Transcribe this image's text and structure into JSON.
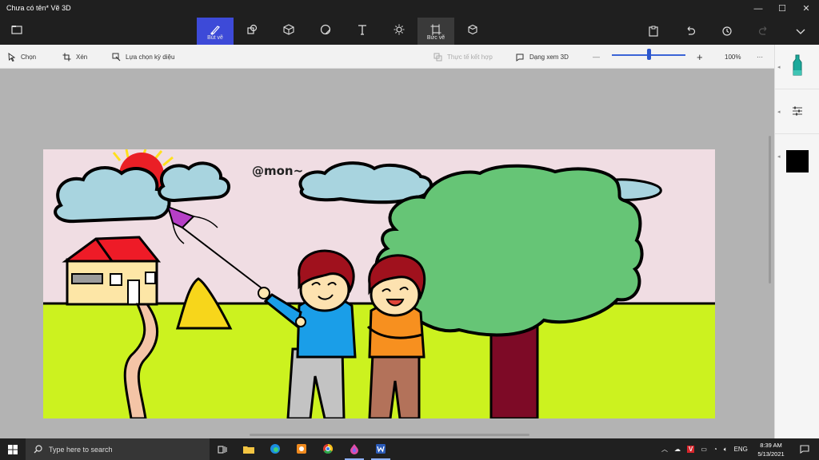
{
  "window": {
    "title": "Chưa có tên*   Vẽ 3D",
    "controls": {
      "minimize": "—",
      "maximize": "☐",
      "close": "✕"
    }
  },
  "ribbon": {
    "tools": [
      {
        "label": "Bút vẽ",
        "icon": "brush-icon",
        "state": "active"
      },
      {
        "label": "",
        "icon": "2d-shapes-icon",
        "state": "normal"
      },
      {
        "label": "",
        "icon": "3d-shapes-icon",
        "state": "normal"
      },
      {
        "label": "",
        "icon": "stickers-icon",
        "state": "normal"
      },
      {
        "label": "",
        "icon": "text-icon",
        "state": "normal"
      },
      {
        "label": "",
        "icon": "effects-icon",
        "state": "normal"
      },
      {
        "label": "Bức vẽ",
        "icon": "canvas-icon",
        "state": "selected"
      },
      {
        "label": "",
        "icon": "3d-library-icon",
        "state": "normal"
      }
    ],
    "right": [
      "paste-icon",
      "undo-icon",
      "history-icon",
      "redo-icon",
      "expand-icon"
    ]
  },
  "subtoolbar": {
    "select_label": "Chọn",
    "crop_label": "Xén",
    "magic_select_label": "Lựa chọn kỳ diệu",
    "mixed_reality_label": "Thực tế kết hợp",
    "view_3d_label": "Dạng xem 3D",
    "zoom_minus": "—",
    "zoom_plus": "+",
    "zoom_value": "100%",
    "more": "···",
    "zoom_fraction": 0.5
  },
  "canvas": {
    "signature": "@mon~"
  },
  "sidepanel": {
    "selected_color": "#000000"
  },
  "taskbar": {
    "search_placeholder": "Type here to search",
    "language": "ENG",
    "time": "8:39 AM",
    "date": "5/13/2021"
  },
  "colors": {
    "ribbon_bg": "#1f1f1f",
    "accent": "#3d4ad8",
    "sky": "#f0dde3",
    "grass": "#ccf21f",
    "cloud": "#a8d4df",
    "tree": "#66c576",
    "trunk": "#7d0a26"
  }
}
